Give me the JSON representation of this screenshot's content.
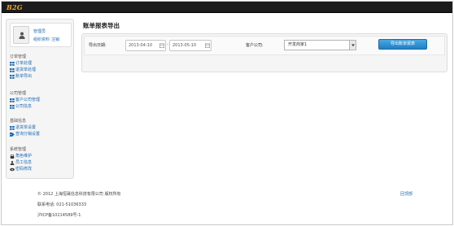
{
  "app": {
    "logo": "B2G"
  },
  "profile": {
    "name": "管理员",
    "links": [
      "组织资料",
      "注销"
    ],
    "avatar_icon": "user-icon"
  },
  "sidebar": {
    "groups": [
      {
        "title": "订单管理",
        "items": [
          {
            "label": "订单处理",
            "icon": "grid-icon"
          },
          {
            "label": "退货单处理",
            "icon": "grid-icon"
          },
          {
            "label": "账单导出",
            "icon": "grid-icon"
          }
        ]
      },
      {
        "title": "公司管理",
        "items": [
          {
            "label": "客户公司管理",
            "icon": "grid-icon"
          },
          {
            "label": "公司信息",
            "icon": "grid-icon"
          }
        ]
      },
      {
        "title": "基础信息",
        "items": [
          {
            "label": "退货单设置",
            "icon": "grid-icon"
          },
          {
            "label": "查询分销设置",
            "icon": "tag-icon"
          }
        ]
      },
      {
        "title": "系统管理",
        "items": [
          {
            "label": "角色维护",
            "icon": "lock-icon"
          },
          {
            "label": "员工信息",
            "icon": "user-icon"
          },
          {
            "label": "密码修改",
            "icon": "eye-icon"
          }
        ]
      }
    ]
  },
  "main": {
    "title": "账单报表导出",
    "export_date_label": "导出日期:",
    "date_from": "2013-04-10",
    "date_to": "2013-05-10",
    "dash": "-",
    "client_company_label": "客户公司:",
    "client_company_selected": "开发商家1",
    "export_button": "导出账单报表"
  },
  "footer": {
    "copyright": "© 2012 上海恒晟信息科技有限公司 版权所有",
    "phone": "联系电话: 021-51036333",
    "icp": "沪ICP备10214589号-1",
    "back_to_top": "回顶部"
  },
  "colors": {
    "topbar": "#1c1c1c",
    "logo": "#f5a623",
    "link": "#1a6bb5",
    "button": "#2a8fd1"
  }
}
